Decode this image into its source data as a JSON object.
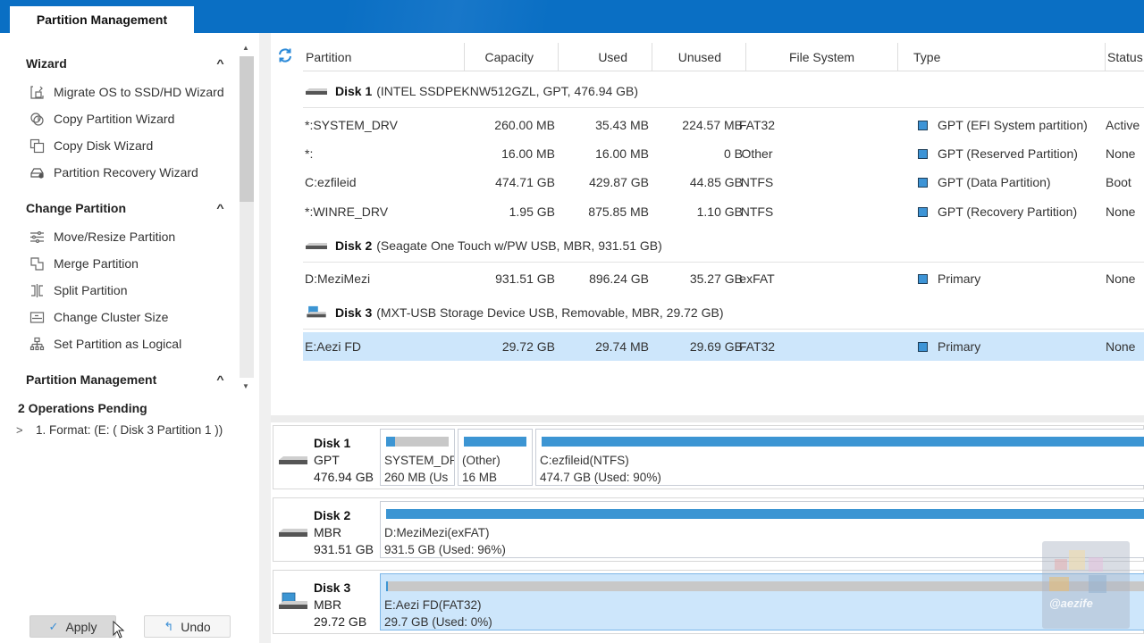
{
  "ribbon": {
    "active_tab": "Partition Management"
  },
  "sidebar": {
    "sections": [
      {
        "title": "Wizard",
        "items": [
          {
            "label": "Migrate OS to SSD/HD Wizard",
            "icon": "migrate-os-icon"
          },
          {
            "label": "Copy Partition Wizard",
            "icon": "copy-partition-icon"
          },
          {
            "label": "Copy Disk Wizard",
            "icon": "copy-disk-icon"
          },
          {
            "label": "Partition Recovery Wizard",
            "icon": "partition-recovery-icon"
          }
        ]
      },
      {
        "title": "Change Partition",
        "items": [
          {
            "label": "Move/Resize Partition",
            "icon": "move-resize-icon"
          },
          {
            "label": "Merge Partition",
            "icon": "merge-icon"
          },
          {
            "label": "Split Partition",
            "icon": "split-icon"
          },
          {
            "label": "Change Cluster Size",
            "icon": "cluster-size-icon"
          },
          {
            "label": "Set Partition as Logical",
            "icon": "logical-icon"
          }
        ]
      },
      {
        "title": "Partition Management",
        "items": []
      }
    ],
    "pending": {
      "title": "2 Operations Pending",
      "items": [
        "1. Format: (E: ( Disk 3 Partition 1 ))"
      ]
    },
    "apply_label": "Apply",
    "undo_label": "Undo"
  },
  "table": {
    "columns": [
      "Partition",
      "Capacity",
      "Used",
      "Unused",
      "File System",
      "Type",
      "Status"
    ],
    "disks": [
      {
        "name": "Disk 1",
        "detail": "(INTEL SSDPEKNW512GZL, GPT, 476.94 GB)",
        "partitions": [
          {
            "partition": "*:SYSTEM_DRV",
            "capacity": "260.00 MB",
            "used": "35.43 MB",
            "unused": "224.57 MB",
            "fs": "FAT32",
            "type": "GPT (EFI System partition)",
            "status": "Active"
          },
          {
            "partition": "*:",
            "capacity": "16.00 MB",
            "used": "16.00 MB",
            "unused": "0 B",
            "fs": "Other",
            "type": "GPT (Reserved Partition)",
            "status": "None"
          },
          {
            "partition": "C:ezfileid",
            "capacity": "474.71 GB",
            "used": "429.87 GB",
            "unused": "44.85 GB",
            "fs": "NTFS",
            "type": "GPT (Data Partition)",
            "status": "Boot"
          },
          {
            "partition": "*:WINRE_DRV",
            "capacity": "1.95 GB",
            "used": "875.85 MB",
            "unused": "1.10 GB",
            "fs": "NTFS",
            "type": "GPT (Recovery Partition)",
            "status": "None"
          }
        ]
      },
      {
        "name": "Disk 2",
        "detail": "(Seagate One Touch w/PW USB, MBR, 931.51 GB)",
        "partitions": [
          {
            "partition": "D:MeziMezi",
            "capacity": "931.51 GB",
            "used": "896.24 GB",
            "unused": "35.27 GB",
            "fs": "exFAT",
            "type": "Primary",
            "status": "None"
          }
        ]
      },
      {
        "name": "Disk 3",
        "detail": "(MXT-USB Storage Device USB, Removable, MBR, 29.72 GB)",
        "partitions": [
          {
            "partition": "E:Aezi FD",
            "capacity": "29.72 GB",
            "used": "29.74 MB",
            "unused": "29.69 GB",
            "fs": "FAT32",
            "type": "Primary",
            "status": "None",
            "selected": true
          }
        ]
      }
    ]
  },
  "disk_map": [
    {
      "name": "Disk 1",
      "scheme": "GPT",
      "size": "476.94 GB",
      "blocks": [
        {
          "label": "SYSTEM_DR",
          "detail": "260 MB (Us",
          "used_fraction": 0.14
        },
        {
          "label": "(Other)",
          "detail": "16 MB",
          "used_fraction": 1.0
        },
        {
          "label": "C:ezfileid(NTFS)",
          "detail": "474.7 GB (Used: 90%)",
          "used_fraction": 0.9
        }
      ]
    },
    {
      "name": "Disk 2",
      "scheme": "MBR",
      "size": "931.51 GB",
      "blocks": [
        {
          "label": "D:MeziMezi(exFAT)",
          "detail": "931.5 GB (Used: 96%)",
          "used_fraction": 0.96
        }
      ]
    },
    {
      "name": "Disk 3",
      "scheme": "MBR",
      "size": "29.72 GB",
      "blocks": [
        {
          "label": "E:Aezi FD(FAT32)",
          "detail": "29.7 GB (Used: 0%)",
          "used_fraction": 0.001,
          "selected": true
        }
      ]
    }
  ],
  "watermark": {
    "text": "@aezife"
  },
  "colors": {
    "accent": "#0a6fc4",
    "bar_fill": "#3c95d3",
    "selection": "#cde6fb"
  }
}
